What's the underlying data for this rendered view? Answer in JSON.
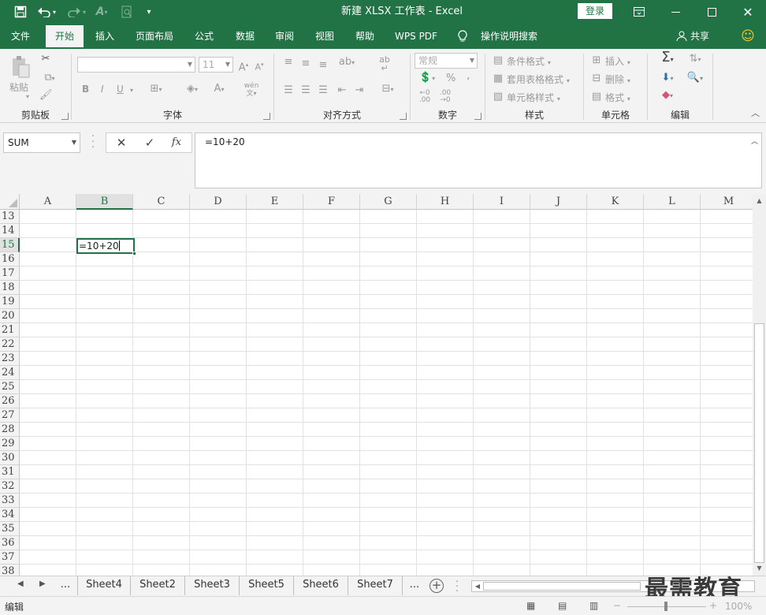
{
  "window": {
    "title": "新建 XLSX 工作表 - Excel",
    "login_label": "登录",
    "colors": {
      "accent": "#217346",
      "ribbon_bg": "#f3f3f3"
    }
  },
  "quick_access": {
    "icons": [
      "save-icon",
      "undo-icon",
      "redo-icon",
      "font-color-icon",
      "print-preview-icon",
      "customize-icon"
    ]
  },
  "tabs": [
    {
      "label": "文件"
    },
    {
      "label": "开始",
      "active": true
    },
    {
      "label": "插入"
    },
    {
      "label": "页面布局"
    },
    {
      "label": "公式"
    },
    {
      "label": "数据"
    },
    {
      "label": "审阅"
    },
    {
      "label": "视图"
    },
    {
      "label": "帮助"
    },
    {
      "label": "WPS PDF"
    },
    {
      "label": "操作说明搜索"
    }
  ],
  "share_label": "共享",
  "ribbon": {
    "clipboard": {
      "label": "剪贴板",
      "paste": "粘贴"
    },
    "font": {
      "label": "字体",
      "font_size": "11",
      "bold": "B",
      "italic": "I",
      "underline": "U",
      "phonetic": "wén"
    },
    "alignment": {
      "label": "对齐方式"
    },
    "number": {
      "label": "数字",
      "format": "常规",
      "percent": "%",
      "comma": ","
    },
    "styles": {
      "label": "样式",
      "conditional": "条件格式",
      "table_format": "套用表格格式",
      "cell_styles": "单元格样式"
    },
    "cells": {
      "label": "单元格",
      "insert": "插入",
      "delete": "删除",
      "format": "格式"
    },
    "editing": {
      "label": "编辑"
    }
  },
  "formula_bar": {
    "name_box": "SUM",
    "cancel": "✕",
    "enter": "✓",
    "fx": "fx",
    "content": "=10+20"
  },
  "grid": {
    "columns": [
      "A",
      "B",
      "C",
      "D",
      "E",
      "F",
      "G",
      "H",
      "I",
      "J",
      "K",
      "L",
      "M"
    ],
    "rows": [
      "13",
      "14",
      "15",
      "16",
      "17",
      "18",
      "19",
      "20",
      "21",
      "22",
      "23",
      "24",
      "25",
      "26",
      "27",
      "28",
      "29",
      "30",
      "31",
      "32",
      "33",
      "34",
      "35",
      "36",
      "37",
      "38"
    ],
    "selected_column": "B",
    "selected_row": "15",
    "active_cell_value": "=10+20"
  },
  "sheets": {
    "overflow": "...",
    "tabs": [
      "Sheet4",
      "Sheet2",
      "Sheet3",
      "Sheet5",
      "Sheet6",
      "Sheet7"
    ],
    "overflow_right": "..."
  },
  "watermark": "最需教育",
  "status": {
    "mode": "编辑",
    "zoom": "100%"
  }
}
